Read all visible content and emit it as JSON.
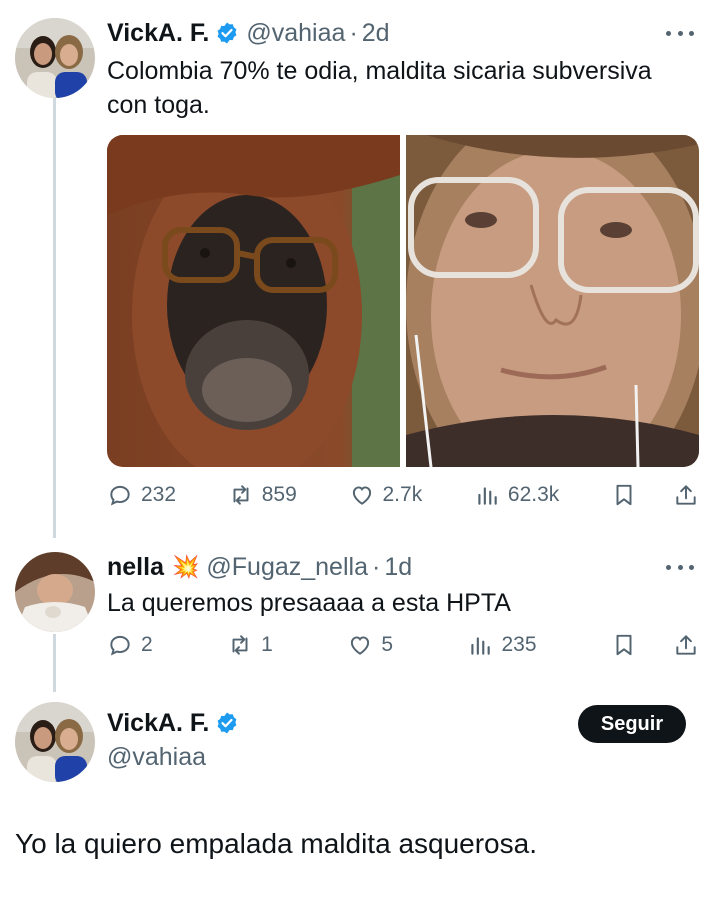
{
  "tweet1": {
    "display_name": "VickA. F.",
    "handle": "@vahiaa",
    "separator": "·",
    "time": "2d",
    "text": "Colombia 70% te odia, maldita sicaria subversiva con toga.",
    "actions": {
      "replies": "232",
      "retweets": "859",
      "likes": "2.7k",
      "views": "62.3k"
    }
  },
  "tweet2": {
    "display_name": "nella",
    "emoji": "💥",
    "handle": "@Fugaz_nella",
    "separator": "·",
    "time": "1d",
    "text": "La queremos presaaaa a esta HPTA",
    "actions": {
      "replies": "2",
      "retweets": "1",
      "likes": "5",
      "views": "235"
    }
  },
  "tweet3": {
    "display_name": "VickA. F.",
    "handle": "@vahiaa",
    "follow_label": "Seguir",
    "text": "Yo la quiero empalada maldita asquerosa."
  },
  "colors": {
    "text": "#0f1419",
    "secondary": "#536471",
    "verified": "#1d9bf0",
    "thread_line": "#cfd9de",
    "follow_bg": "#0f1419"
  }
}
